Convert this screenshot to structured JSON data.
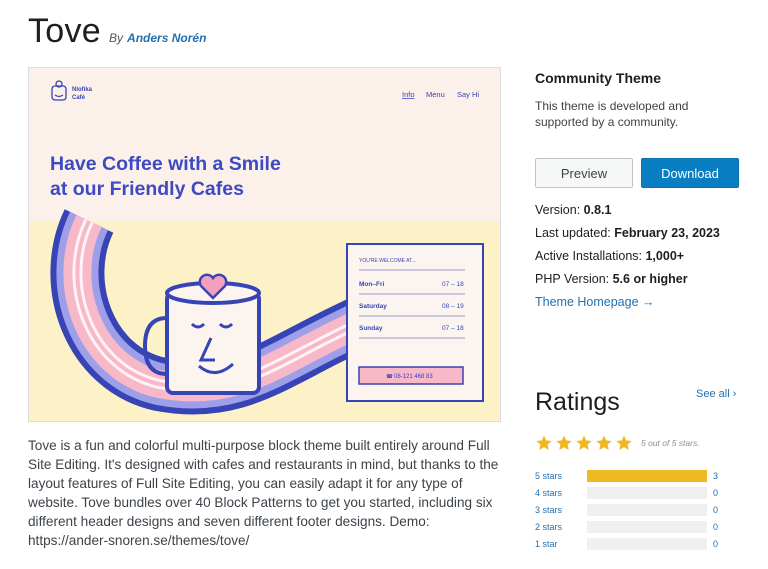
{
  "theme": {
    "name": "Tove",
    "by": "By",
    "author": "Anders Norén"
  },
  "description": "Tove is a fun and colorful multi-purpose block theme built entirely around Full Site Editing. It's designed with cafes and restaurants in mind, but thanks to the layout features of Full Site Editing, you can easily adapt it for any type of website. Tove bundles over 40 Block Patterns to get you started, including six different header designs and seven different footer designs. Demo: https://ander-snoren.se/themes/tove/",
  "preview": {
    "brand_line1": "Nlofika",
    "brand_line2": "Café",
    "nav": [
      "Info",
      "Menu",
      "Say Hi"
    ],
    "headline_line1": "Have Coffee with a Smile",
    "headline_line2": "at our Friendly Cafes",
    "card_title": "YOU'RE WELCOME AT...",
    "hours": [
      {
        "day": "Mon–Fri",
        "time": "07 – 18"
      },
      {
        "day": "Saturday",
        "time": "08 – 19"
      },
      {
        "day": "Sunday",
        "time": "07 – 18"
      }
    ],
    "phone": "08-121 468 83",
    "colors": {
      "bg": "#fcf0ea",
      "yellow": "#fdf1c7",
      "blue": "#3644b5",
      "lilac": "#9d9fe8",
      "pink": "#f7b8c8",
      "accent": "#2d3ab1"
    }
  },
  "sidebar": {
    "heading": "Community Theme",
    "text": "This theme is developed and supported by a community.",
    "preview_label": "Preview",
    "download_label": "Download",
    "version_label": "Version:",
    "version": "0.8.1",
    "updated_label": "Last updated:",
    "updated": "February 23, 2023",
    "installs_label": "Active Installations:",
    "installs": "1,000+",
    "php_label": "PHP Version:",
    "php": "5.6 or higher",
    "homepage_label": "Theme Homepage →"
  },
  "ratings": {
    "title": "Ratings",
    "see_all": "See all ›",
    "summary": "5 out of 5 stars.",
    "star_color": "#f0b924",
    "stars_value": 5,
    "rows": [
      {
        "label": "5 stars",
        "count": "3",
        "fraction": 1.0
      },
      {
        "label": "4 stars",
        "count": "0",
        "fraction": 0
      },
      {
        "label": "3 stars",
        "count": "0",
        "fraction": 0
      },
      {
        "label": "2 stars",
        "count": "0",
        "fraction": 0
      },
      {
        "label": "1 star",
        "count": "0",
        "fraction": 0
      }
    ]
  }
}
